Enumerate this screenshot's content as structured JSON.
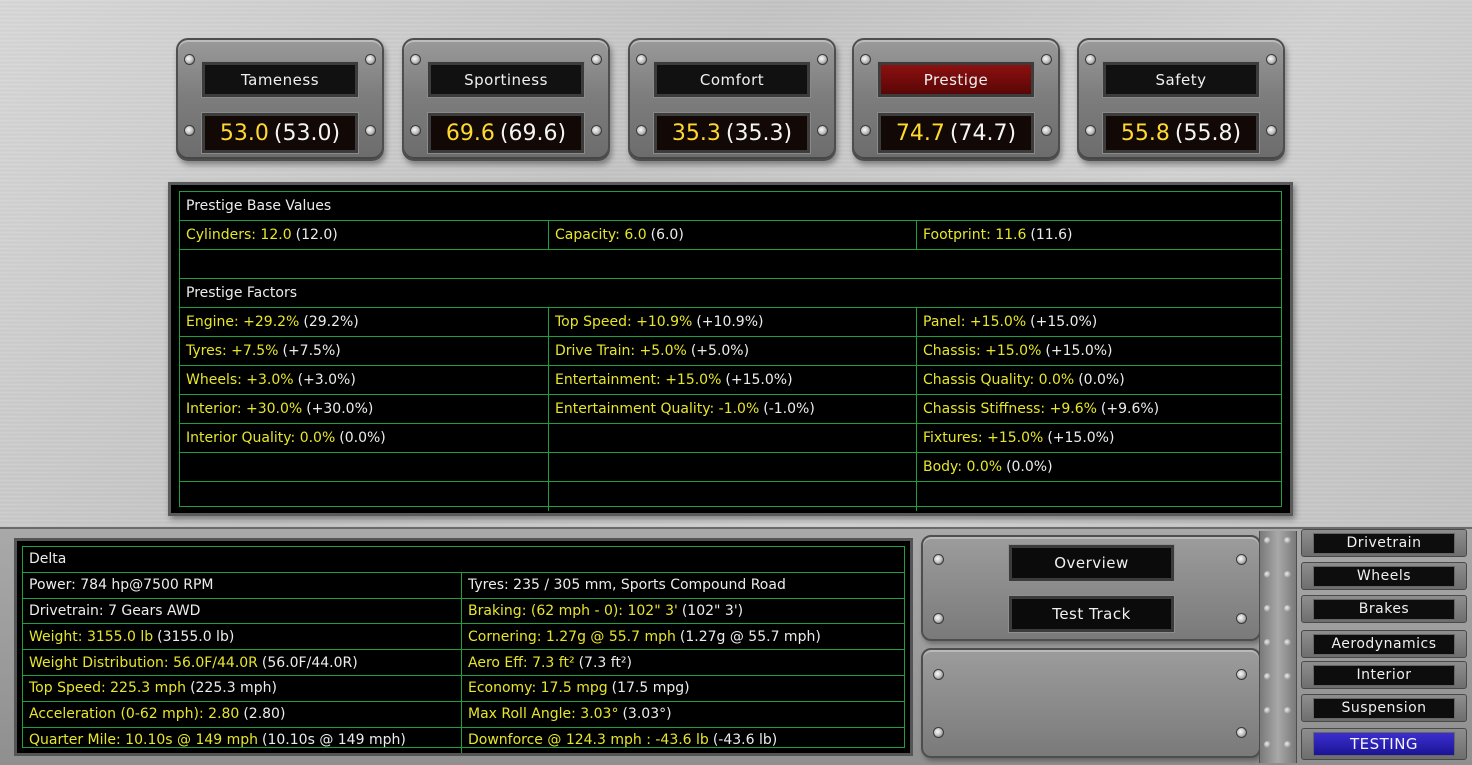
{
  "ratings": [
    {
      "label": "Tameness",
      "value": "53.0",
      "base": "(53.0)",
      "active": false
    },
    {
      "label": "Sportiness",
      "value": "69.6",
      "base": "(69.6)",
      "active": false
    },
    {
      "label": "Comfort",
      "value": "35.3",
      "base": "(35.3)",
      "active": false
    },
    {
      "label": "Prestige",
      "value": "74.7",
      "base": "(74.7)",
      "active": true
    },
    {
      "label": "Safety",
      "value": "55.8",
      "base": "(55.8)",
      "active": false
    }
  ],
  "prestige": {
    "base_title": "Prestige Base Values",
    "base_values": [
      {
        "label": "Cylinders: 12.0",
        "paren": "(12.0)"
      },
      {
        "label": "Capacity: 6.0",
        "paren": "(6.0)"
      },
      {
        "label": "Footprint: 11.6",
        "paren": "(11.6)"
      }
    ],
    "factors_title": "Prestige Factors",
    "factors": [
      [
        {
          "label": "Engine: +29.2%",
          "paren": "(29.2%)"
        },
        {
          "label": "Top Speed: +10.9%",
          "paren": "(+10.9%)"
        },
        {
          "label": "Panel: +15.0%",
          "paren": "(+15.0%)"
        }
      ],
      [
        {
          "label": "Tyres: +7.5%",
          "paren": "(+7.5%)"
        },
        {
          "label": "Drive Train: +5.0%",
          "paren": "(+5.0%)"
        },
        {
          "label": "Chassis: +15.0%",
          "paren": "(+15.0%)"
        }
      ],
      [
        {
          "label": "Wheels: +3.0%",
          "paren": "(+3.0%)"
        },
        {
          "label": "Entertainment: +15.0%",
          "paren": "(+15.0%)"
        },
        {
          "label": "Chassis Quality: 0.0%",
          "paren": "(0.0%)"
        }
      ],
      [
        {
          "label": "Interior: +30.0%",
          "paren": "(+30.0%)"
        },
        {
          "label": "Entertainment Quality: -1.0%",
          "paren": "(-1.0%)"
        },
        {
          "label": "Chassis Stiffness: +9.6%",
          "paren": "(+9.6%)"
        }
      ],
      [
        {
          "label": "Interior Quality: 0.0%",
          "paren": "(0.0%)"
        },
        {
          "label": "",
          "paren": ""
        },
        {
          "label": "Fixtures: +15.0%",
          "paren": "(+15.0%)"
        }
      ],
      [
        {
          "label": "",
          "paren": ""
        },
        {
          "label": "",
          "paren": ""
        },
        {
          "label": "Body: 0.0%",
          "paren": "(0.0%)"
        }
      ]
    ]
  },
  "stats": {
    "title": "Delta",
    "rows": [
      [
        {
          "label": "Power: 784 hp@7500 RPM",
          "paren": "",
          "hl": false
        },
        {
          "label": "Tyres: 235 / 305 mm, Sports Compound Road",
          "paren": "",
          "hl": false
        }
      ],
      [
        {
          "label": "Drivetrain: 7 Gears AWD",
          "paren": "",
          "hl": false
        },
        {
          "label": "Braking: (62 mph - 0): 102\" 3'",
          "paren": "(102\" 3')",
          "hl": true
        }
      ],
      [
        {
          "label": "Weight: 3155.0 lb",
          "paren": "(3155.0 lb)",
          "hl": true
        },
        {
          "label": "Cornering: 1.27g @ 55.7 mph",
          "paren": "(1.27g @ 55.7 mph)",
          "hl": true
        }
      ],
      [
        {
          "label": "Weight Distribution: 56.0F/44.0R",
          "paren": "(56.0F/44.0R)",
          "hl": true
        },
        {
          "label": "Aero Eff: 7.3 ft²",
          "paren": "(7.3 ft²)",
          "hl": true
        }
      ],
      [
        {
          "label": "Top Speed: 225.3 mph",
          "paren": "(225.3 mph)",
          "hl": true
        },
        {
          "label": "Economy: 17.5 mpg",
          "paren": "(17.5 mpg)",
          "hl": true
        }
      ],
      [
        {
          "label": "Acceleration (0-62 mph): 2.80",
          "paren": "(2.80)",
          "hl": true
        },
        {
          "label": "Max Roll Angle: 3.03°",
          "paren": "(3.03°)",
          "hl": true
        }
      ],
      [
        {
          "label": "Quarter Mile: 10.10s @ 149 mph",
          "paren": "(10.10s @ 149 mph)",
          "hl": true
        },
        {
          "label": "Downforce @ 124.3 mph : -43.6 lb",
          "paren": "(-43.6 lb)",
          "hl": true
        }
      ]
    ]
  },
  "nav": {
    "overview": "Overview",
    "test_track": "Test Track"
  },
  "tabs": [
    {
      "label": "Drivetrain",
      "selected": false
    },
    {
      "label": "Wheels",
      "selected": false
    },
    {
      "label": "Brakes",
      "selected": false
    },
    {
      "label": "Aerodynamics",
      "selected": false
    },
    {
      "label": "Interior",
      "selected": false
    },
    {
      "label": "Suspension",
      "selected": false
    },
    {
      "label": "TESTING",
      "selected": true
    }
  ],
  "colors": {
    "highlight": "#e6e62a",
    "value": "#ffd92e",
    "grid": "#1fa03c",
    "active_label": "#8c1010",
    "selected_tab": "#2a20b8"
  }
}
